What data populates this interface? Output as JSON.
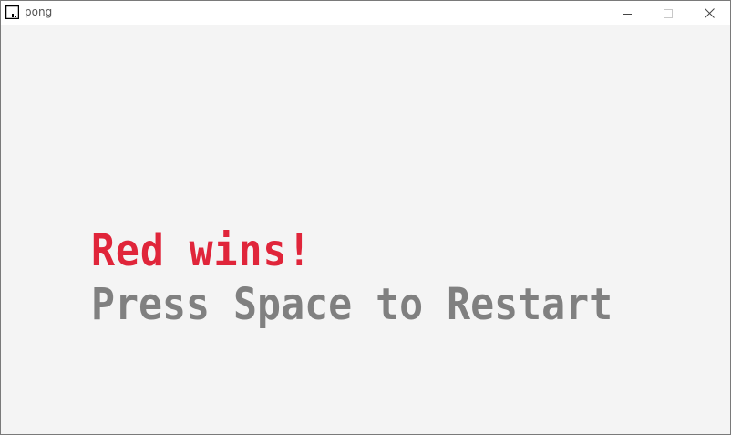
{
  "window": {
    "title": "pong",
    "controls": [
      "minimize",
      "maximize",
      "close"
    ]
  },
  "icons": {
    "app": "pong-app-icon",
    "minimize": "minimize-icon",
    "maximize": "maximize-icon",
    "close": "close-icon"
  },
  "game": {
    "winner_text": "Red wins!",
    "restart_prompt": "Press Space to Restart"
  },
  "colors": {
    "background": "#f4f4f4",
    "winner": "#e0253a",
    "prompt": "#808080",
    "titlebar": "#ffffff"
  }
}
